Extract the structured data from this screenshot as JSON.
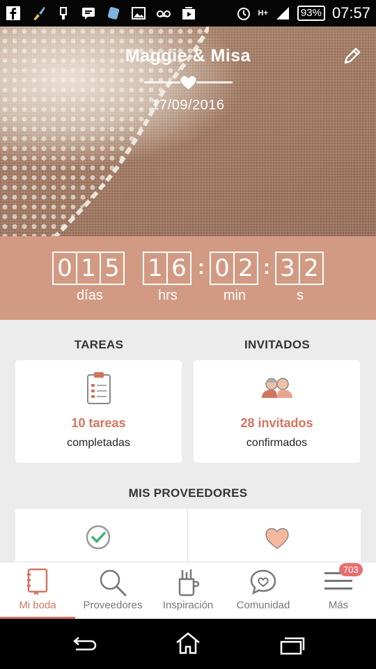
{
  "header": {
    "couple_names": "Maggie & Misa",
    "wedding_date": "17/09/2016"
  },
  "status_bar": {
    "battery": "93%",
    "time": "07:57",
    "network": "H+"
  },
  "countdown": {
    "days_digits": [
      "0",
      "1",
      "5"
    ],
    "hours_digits": [
      "1",
      "6"
    ],
    "minutes_digits": [
      "0",
      "2"
    ],
    "seconds_digits": [
      "3",
      "2"
    ],
    "days_label": "días",
    "hours_label": "hrs",
    "minutes_label": "min",
    "seconds_label": "s",
    "separator": ":"
  },
  "tasks": {
    "title": "TAREAS",
    "value": "10 tareas",
    "sub": "completadas"
  },
  "guests": {
    "title": "INVITADOS",
    "value": "28 invitados",
    "sub": "confirmados"
  },
  "vendors": {
    "title": "MIS PROVEEDORES"
  },
  "bottom_nav": {
    "items": [
      {
        "label": "Mi boda",
        "icon": "notebook-icon"
      },
      {
        "label": "Proveedores",
        "icon": "search-icon"
      },
      {
        "label": "Inspiración",
        "icon": "pencil-cup-icon"
      },
      {
        "label": "Comunidad",
        "icon": "chat-heart-icon"
      },
      {
        "label": "Más",
        "icon": "menu-icon"
      }
    ],
    "badge": "703"
  },
  "colors": {
    "accent": "#d17560",
    "countdown_bg": "#d29a83"
  }
}
